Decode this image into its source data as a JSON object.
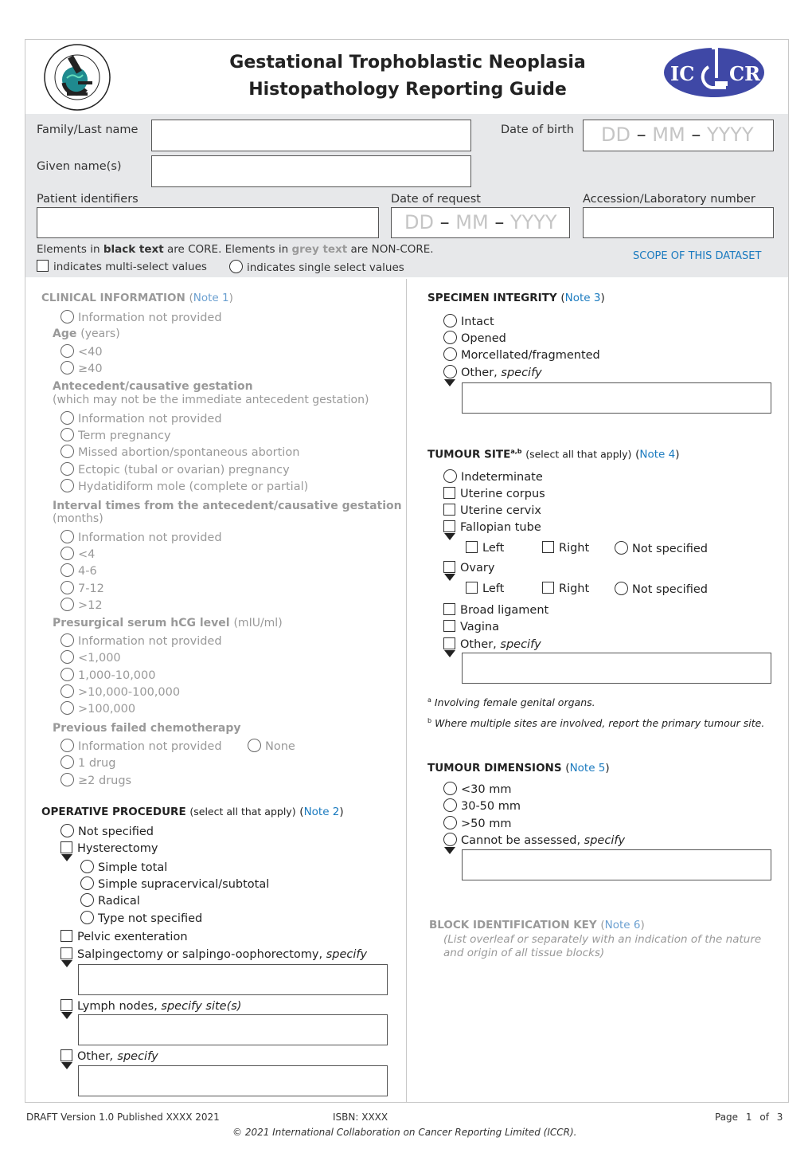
{
  "header": {
    "title_line1": "Gestational Trophoblastic Neoplasia",
    "title_line2": "Histopathology Reporting Guide",
    "left_logo": "isgyp-logo",
    "right_logo": "iccr-logo",
    "right_logo_text_left": "IC",
    "right_logo_text_right": "CR",
    "brand_color": "#3f48a6"
  },
  "patient": {
    "family_name_label": "Family/Last name",
    "given_names_label": "Given name(s)",
    "dob_label": "Date of birth",
    "date_placeholder": {
      "dd": "DD",
      "mm": "MM",
      "yyyy": "YYYY",
      "sep": "–"
    },
    "patient_identifiers_label": "Patient identifiers",
    "date_of_request_label": "Date of request",
    "accession_label": "Accession/Laboratory number",
    "legend_part1": "Elements in ",
    "legend_black": "black text",
    "legend_part2": " are CORE. Elements in ",
    "legend_grey": "grey text",
    "legend_part3": " are NON-CORE.",
    "multi_select_legend": "indicates multi-select values",
    "single_select_legend": "indicates single select values",
    "scope_link": "SCOPE OF THIS DATASET"
  },
  "clinical": {
    "title": "CLINICAL INFORMATION",
    "note": "Note 1",
    "info_not_provided": "Information not provided",
    "age_label": "Age",
    "age_unit": "(years)",
    "age_options": [
      "<40",
      "≥40"
    ],
    "antecedent_label": "Antecedent/causative gestation",
    "antecedent_sub": "(which may not be the immediate antecedent gestation)",
    "antecedent_options": [
      "Information not provided",
      "Term pregnancy",
      "Missed abortion/spontaneous abortion",
      "Ectopic (tubal or ovarian) pregnancy",
      "Hydatidiform mole (complete or partial)"
    ],
    "interval_label": "Interval times from the antecedent/causative gestation",
    "interval_unit": "(months)",
    "interval_options": [
      "Information not provided",
      "<4",
      "4-6",
      "7-12",
      ">12"
    ],
    "hcg_label": "Presurgical serum hCG level",
    "hcg_unit": "(mIU/ml)",
    "hcg_options": [
      "Information not provided",
      "<1,000",
      "1,000-10,000",
      ">10,000-100,000",
      ">100,000"
    ],
    "chemo_label": "Previous failed chemotherapy",
    "chemo_options": [
      "Information not provided",
      "None",
      "1 drug",
      "≥2 drugs"
    ]
  },
  "operative": {
    "title": "OPERATIVE PROCEDURE",
    "qualifier": "(select all that apply)",
    "note": "Note 2",
    "not_specified": "Not specified",
    "hysterectomy": "Hysterectomy",
    "hysterectomy_options": [
      "Simple total",
      "Simple supracervical/subtotal",
      "Radical",
      "Type not specified"
    ],
    "pelvic": "Pelvic exenteration",
    "salpingectomy": "Salpingectomy or salpingo-oophorectomy, ",
    "lymph": "Lymph nodes, ",
    "lymph_specify": "specify site(s)",
    "other": "Other",
    "other_specify": ", specify",
    "specify": "specify"
  },
  "integrity": {
    "title": "SPECIMEN INTEGRITY",
    "note": "Note 3",
    "options": [
      "Intact",
      "Opened",
      "Morcellated/fragmented"
    ],
    "other": "Other, ",
    "specify": "specify"
  },
  "site": {
    "title": "TUMOUR SITE",
    "superscript": "a,b",
    "qualifier": "(select all that apply)",
    "note": "Note 4",
    "indeterminate": "Indeterminate",
    "uterine_corpus": "Uterine corpus",
    "uterine_cervix": "Uterine cervix",
    "fallopian": "Fallopian tube",
    "ovary": "Ovary",
    "laterality": [
      "Left",
      "Right",
      "Not specified"
    ],
    "broad": "Broad ligament",
    "vagina": "Vagina",
    "other": "Other, ",
    "specify": "specify",
    "footnote_a_mark": "a",
    "footnote_a": "Involving female genital organs.",
    "footnote_b_mark": "b",
    "footnote_b": "Where multiple sites are involved, report the primary tumour site."
  },
  "dimensions": {
    "title": "TUMOUR DIMENSIONS",
    "note": "Note 5",
    "options": [
      "<30 mm",
      "30-50 mm",
      ">50 mm"
    ],
    "cannot": "Cannot be assessed, ",
    "specify": "specify"
  },
  "block": {
    "title": "BLOCK IDENTIFICATION KEY",
    "note": "Note 6",
    "desc_line1": "(List overleaf or separately with an indication of the nature",
    "desc_line2": "and origin of all tissue blocks)"
  },
  "footer": {
    "version": "DRAFT Version 1.0 Published XXXX 2021",
    "isbn": "ISBN: XXXX",
    "page_label": "Page",
    "page": "1",
    "of_label": "of",
    "total_pages": "3",
    "copyright": "© 2021 International Collaboration on Cancer Reporting Limited (ICCR)."
  }
}
